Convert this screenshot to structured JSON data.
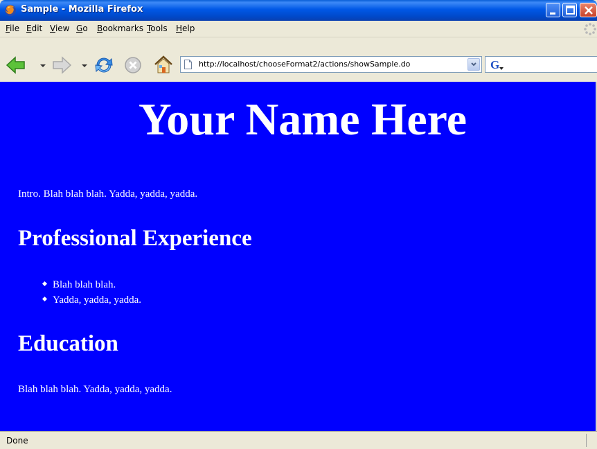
{
  "window": {
    "title": "Sample - Mozilla Firefox",
    "app_icon": "firefox-icon"
  },
  "menu": {
    "items": [
      {
        "label": "File",
        "u": "F",
        "rest": "ile"
      },
      {
        "label": "Edit",
        "u": "E",
        "rest": "dit"
      },
      {
        "label": "View",
        "u": "V",
        "rest": "iew"
      },
      {
        "label": "Go",
        "u": "G",
        "rest": "o"
      },
      {
        "label": "Bookmarks",
        "u": "B",
        "rest": "ookmarks"
      },
      {
        "label": "Tools",
        "u": "T",
        "rest": "ools"
      },
      {
        "label": "Help",
        "u": "H",
        "rest": "elp"
      }
    ]
  },
  "toolbar": {
    "back_icon": "back-arrow-icon",
    "forward_icon": "forward-arrow-icon",
    "reload_icon": "reload-icon",
    "stop_icon": "stop-icon",
    "home_icon": "home-icon",
    "url": "http://localhost/chooseFormat2/actions/showSample.do",
    "search_engine_icon": "google-icon"
  },
  "page": {
    "background": "#0000ff",
    "text_color": "#ffffff",
    "name_heading": "Your Name Here",
    "intro": "Intro. Blah blah blah. Yadda, yadda, yadda.",
    "experience_heading": "Professional Experience",
    "experience_items": [
      "Blah blah blah.",
      "Yadda, yadda, yadda."
    ],
    "education_heading": "Education",
    "education_text": "Blah blah blah. Yadda, yadda, yadda."
  },
  "status": {
    "text": "Done"
  }
}
